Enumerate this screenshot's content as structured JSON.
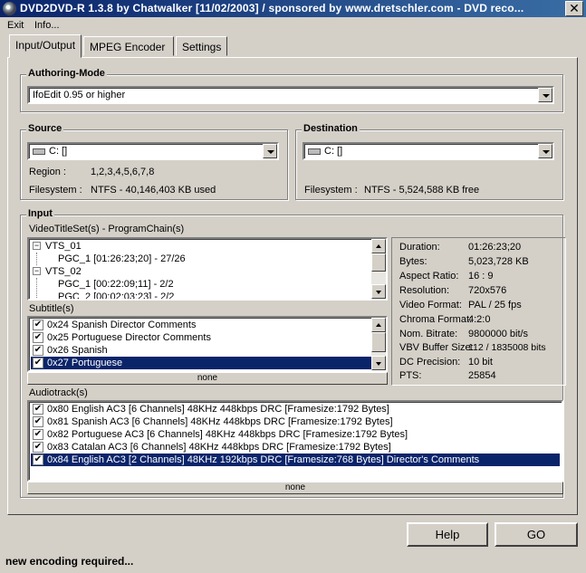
{
  "window": {
    "title": "DVD2DVD-R 1.3.8 by Chatwalker [11/02/2003]   /   sponsored by www.dretschler.com - DVD reco...",
    "close_glyph": "✕"
  },
  "menu": [
    "Exit",
    "Info..."
  ],
  "tabs": [
    "Input/Output",
    "MPEG Encoder",
    "Settings"
  ],
  "authoring": {
    "label": "Authoring-Mode",
    "value": "IfoEdit 0.95 or higher"
  },
  "source": {
    "label": "Source",
    "drive": "C: []",
    "region_label": "Region :",
    "region_value": "1,2,3,4,5,6,7,8",
    "filesystem_label": "Filesystem :",
    "filesystem_value": "NTFS - 40,146,403 KB used"
  },
  "destination": {
    "label": "Destination",
    "drive": "C: []",
    "filesystem_label": "Filesystem :",
    "filesystem_value": "NTFS - 5,524,588 KB free"
  },
  "input": {
    "label": "Input",
    "vts_label": "VideoTitleSet(s) - ProgramChain(s)",
    "tree": [
      {
        "text": "VTS_01",
        "level": 0,
        "box": "−"
      },
      {
        "text": "PGC_1 [01:26:23;20] - 27/26",
        "level": 1
      },
      {
        "text": "VTS_02",
        "level": 0,
        "box": "−"
      },
      {
        "text": "PGC_1 [00:22:09;11] - 2/2",
        "level": 1
      },
      {
        "text": "PGC_2 [00:02:03;23] - 2/2",
        "level": 1
      }
    ],
    "subtitle_label": "Subtitle(s)",
    "subtitles": [
      {
        "text": "0x24 Spanish Director Comments",
        "checked": true,
        "selected": false
      },
      {
        "text": "0x25 Portuguese Director Comments",
        "checked": true,
        "selected": false
      },
      {
        "text": "0x26 Spanish",
        "checked": true,
        "selected": false
      },
      {
        "text": "0x27 Portuguese",
        "checked": true,
        "selected": true
      }
    ],
    "subtitle_none": "none",
    "audio_label": "Audiotrack(s)",
    "audio": [
      {
        "text": "0x80  English  AC3  [6 Channels]  48KHz  448kbps  DRC  [Framesize:1792 Bytes]",
        "checked": true,
        "selected": false
      },
      {
        "text": "0x81  Spanish  AC3  [6 Channels]  48KHz  448kbps  DRC  [Framesize:1792 Bytes]",
        "checked": true,
        "selected": false
      },
      {
        "text": "0x82  Portuguese AC3  [6 Channels]  48KHz  448kbps  DRC  [Framesize:1792 Bytes]",
        "checked": true,
        "selected": false
      },
      {
        "text": "0x83  Catalan  AC3  [6 Channels]  48KHz  448kbps  DRC  [Framesize:1792 Bytes]",
        "checked": true,
        "selected": false
      },
      {
        "text": "0x84  English  AC3  [2 Channels]  48KHz  192kbps  DRC  [Framesize:768 Bytes]  Director's Comments",
        "checked": true,
        "selected": true
      }
    ],
    "audio_none": "none"
  },
  "info": [
    {
      "label": "Duration:",
      "value": "01:26:23;20"
    },
    {
      "label": "Bytes:",
      "value": "5,023,728 KB"
    },
    {
      "label": "Aspect Ratio:",
      "value": "16 : 9"
    },
    {
      "label": "Resolution:",
      "value": "720x576"
    },
    {
      "label": "Video Format:",
      "value": "PAL / 25 fps"
    },
    {
      "label": "Chroma Format:",
      "value": "4:2:0"
    },
    {
      "label": "Nom. Bitrate:",
      "value": "9800000 bit/s"
    },
    {
      "label": "VBV Buffer Size:",
      "value": "112 / 1835008 bits"
    },
    {
      "label": "DC Precision:",
      "value": "10 bit"
    },
    {
      "label": "PTS:",
      "value": "25854"
    }
  ],
  "buttons": {
    "help": "Help",
    "go": "GO"
  },
  "status": "new encoding required..."
}
